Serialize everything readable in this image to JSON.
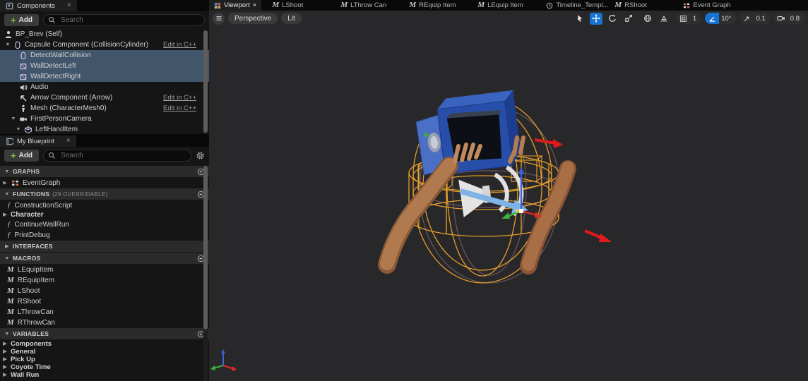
{
  "colors": {
    "selection": "#42566b",
    "wireframe_orange": "#e39b2d",
    "wireframe_mauve": "#6b575f",
    "tool_active_blue": "#1673d1",
    "add_plus_green": "#8cc63f",
    "gizmo_red": "#e02b20",
    "gizmo_green": "#3fae3f",
    "gizmo_blue": "#3a63d8"
  },
  "components_panel": {
    "tab_label": "Components",
    "add_label": "Add",
    "search_placeholder": "Search",
    "edit_link_label": "Edit in C++",
    "rows": [
      {
        "label": "BP_Brev (Self)"
      },
      {
        "label": "Capsule Component (CollisionCylinder)"
      },
      {
        "label": "DetectWallCollision"
      },
      {
        "label": "WallDetectLeft"
      },
      {
        "label": "WallDetectRight"
      },
      {
        "label": "Audio"
      },
      {
        "label": "Arrow Component (Arrow)"
      },
      {
        "label": "Mesh (CharacterMesh0)"
      },
      {
        "label": "FirstPersonCamera"
      },
      {
        "label": "LeftHandItem"
      }
    ]
  },
  "my_blueprint_panel": {
    "tab_label": "My Blueprint",
    "add_label": "Add",
    "search_placeholder": "Search",
    "graphs_header": "GRAPHS",
    "graphs_items": [
      "EventGraph"
    ],
    "functions_header": "FUNCTIONS",
    "functions_suffix": "(29 OVERRIDABLE)",
    "functions_items": [
      "ConstructionScript"
    ],
    "functions_category": "Character",
    "functions_category_items": [
      "ContinueWallRun",
      "PrintDebug"
    ],
    "interfaces_header": "INTERFACES",
    "macros_header": "MACROS",
    "macros_items": [
      "LEquipItem",
      "REquipItem",
      "LShoot",
      "RShoot",
      "LThrowCan",
      "RThrowCan"
    ],
    "variables_header": "VARIABLES",
    "variables_categories": [
      "Components",
      "General",
      "Pick Up",
      "Coyote Time",
      "Wall Run"
    ]
  },
  "viewport": {
    "tabs": [
      "Viewport",
      "LShoot",
      "LThrow Can",
      "REquip Item",
      "LEquip Item",
      "Timeline_Templ...",
      "RShoot",
      "Event Graph"
    ],
    "perspective_label": "Perspective",
    "lit_label": "Lit",
    "grid_snap_value": "1",
    "rotation_snap_value": "10°",
    "scale_snap_value": "0.1",
    "camera_speed_value": "0.8"
  }
}
